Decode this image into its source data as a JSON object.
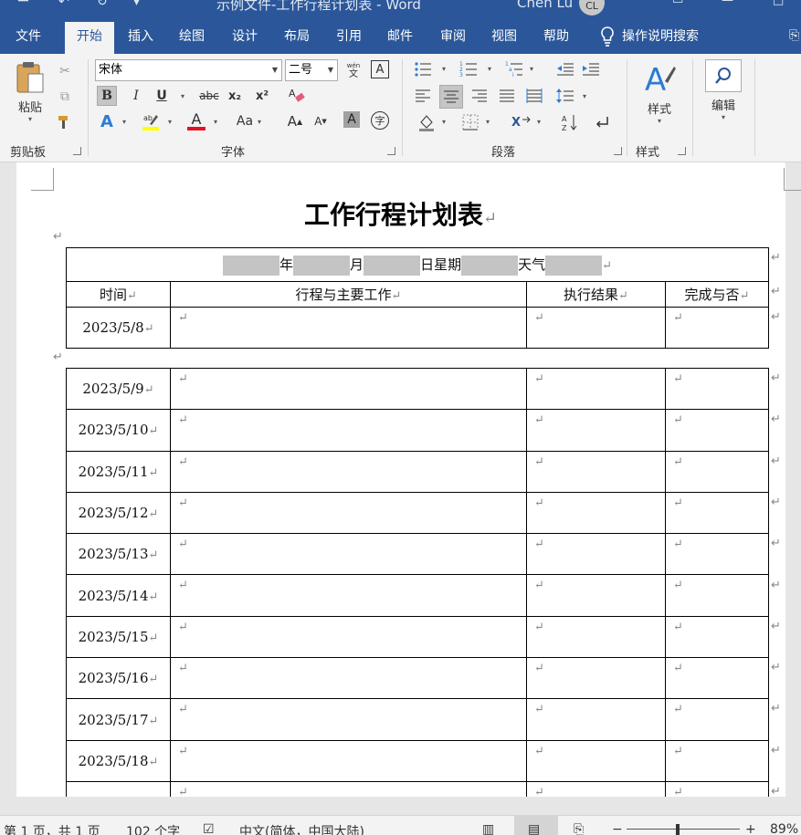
{
  "window": {
    "title": "示例文件-工作行程计划表 - Word",
    "user_name": "Chen Lu",
    "user_initials": "CL"
  },
  "tabs": [
    "文件",
    "开始",
    "插入",
    "绘图",
    "设计",
    "布局",
    "引用",
    "邮件",
    "审阅",
    "视图",
    "帮助"
  ],
  "active_tab": "开始",
  "tell_me": "操作说明搜索",
  "ribbon": {
    "clipboard": {
      "paste_label": "粘贴",
      "group_label": "剪贴板"
    },
    "font": {
      "font_name": "宋体",
      "font_size": "二号",
      "group_label": "字体",
      "bold": "B",
      "italic": "I",
      "underline": "U",
      "strike": "abc",
      "subscript": "x₂",
      "superscript": "x²",
      "change_case": "Aa",
      "grow": "A",
      "shrink": "A",
      "char_border": "A",
      "enclose": "字",
      "highlight_color": "#ffff00",
      "font_color": "#e81123"
    },
    "paragraph": {
      "group_label": "段落"
    },
    "styles": {
      "label": "样式",
      "group_label": "样式"
    },
    "editing": {
      "label": "编辑"
    }
  },
  "document": {
    "title": "工作行程计划表",
    "header_row": {
      "year": "年",
      "month": "月",
      "day_weekday": "日星期",
      "weather": "天气"
    },
    "columns": [
      "时间",
      "行程与主要工作",
      "执行结果",
      "完成与否"
    ],
    "first_table_dates": [
      "2023/5/8"
    ],
    "second_table_dates": [
      "2023/5/9",
      "2023/5/10",
      "2023/5/11",
      "2023/5/12",
      "2023/5/13",
      "2023/5/14",
      "2023/5/15",
      "2023/5/16",
      "2023/5/17",
      "2023/5/18",
      ""
    ],
    "return_mark": "↵"
  },
  "status": {
    "page": "第 1 页，共 1 页",
    "words": "102 个字",
    "language": "中文(简体，中国大陆)",
    "zoom": "89%",
    "zoom_minus": "−",
    "zoom_plus": "+"
  },
  "colors": {
    "accent": "#2b579a"
  }
}
